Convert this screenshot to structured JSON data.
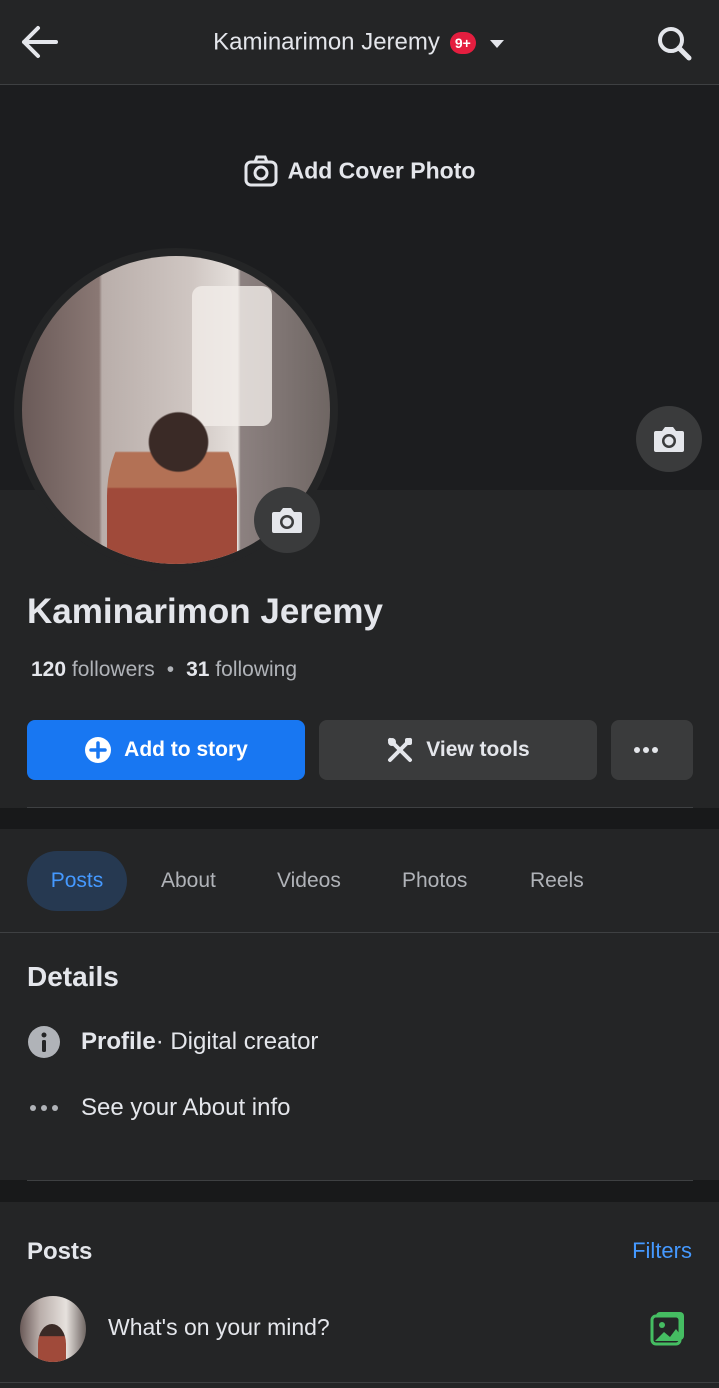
{
  "header": {
    "title": "Kaminarimon Jeremy",
    "badge": "9+"
  },
  "cover": {
    "add_cover_label": "Add Cover Photo"
  },
  "profile": {
    "name": "Kaminarimon Jeremy",
    "followers_count": "120",
    "followers_label": "followers",
    "separator": "•",
    "following_count": "31",
    "following_label": "following"
  },
  "actions": {
    "add_story": "Add to story",
    "view_tools": "View tools",
    "more": "..."
  },
  "tabs": [
    {
      "label": "Posts",
      "active": true
    },
    {
      "label": "About"
    },
    {
      "label": "Videos"
    },
    {
      "label": "Photos"
    },
    {
      "label": "Reels"
    }
  ],
  "details": {
    "title": "Details",
    "profile_label": "Profile",
    "profile_value": " · Digital creator",
    "about_link": "See your About info"
  },
  "posts": {
    "title": "Posts",
    "filters": "Filters",
    "composer_placeholder": "What's on your mind?"
  },
  "colors": {
    "accent": "#1877f2",
    "link": "#4599ff",
    "badge": "#e41e3f",
    "photo_icon": "#45bd62"
  }
}
